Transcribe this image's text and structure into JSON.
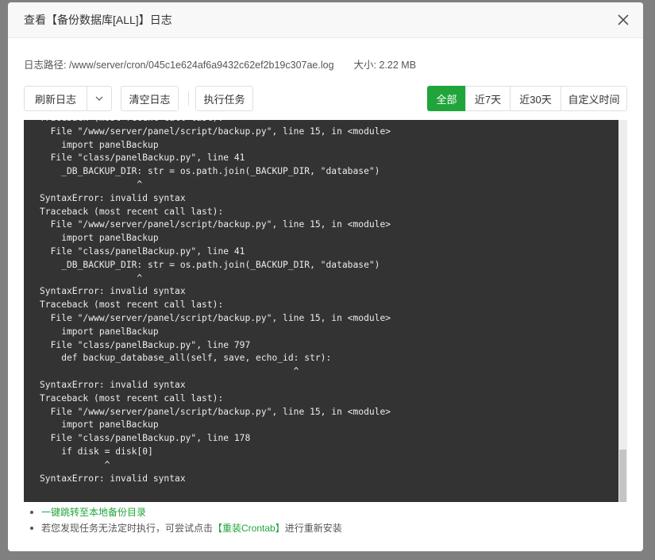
{
  "dialog": {
    "title": "查看【备份数据库[ALL]】日志"
  },
  "info": {
    "path_label": "日志路径:",
    "path_value": "/www/server/cron/045c1e624af6a9432c62ef2b19c307ae.log",
    "size_label": "大小:",
    "size_value": "2.22 MB"
  },
  "toolbar": {
    "refresh_label": "刷新日志",
    "clear_label": "清空日志",
    "exec_label": "执行任务",
    "filters": [
      "全部",
      "近7天",
      "近30天",
      "自定义时间"
    ],
    "active_filter": "全部"
  },
  "log": {
    "text": "Traceback (most recent call last):\n  File \"/www/server/panel/script/backup.py\", line 15, in <module>\n    import panelBackup\n  File \"class/panelBackup.py\", line 41\n    _DB_BACKUP_DIR: str = os.path.join(_BACKUP_DIR, \"database\")\n                  ^\nSyntaxError: invalid syntax\nTraceback (most recent call last):\n  File \"/www/server/panel/script/backup.py\", line 15, in <module>\n    import panelBackup\n  File \"class/panelBackup.py\", line 41\n    _DB_BACKUP_DIR: str = os.path.join(_BACKUP_DIR, \"database\")\n                  ^\nSyntaxError: invalid syntax\nTraceback (most recent call last):\n  File \"/www/server/panel/script/backup.py\", line 15, in <module>\n    import panelBackup\n  File \"class/panelBackup.py\", line 797\n    def backup_database_all(self, save, echo_id: str):\n                                               ^\nSyntaxError: invalid syntax\nTraceback (most recent call last):\n  File \"/www/server/panel/script/backup.py\", line 15, in <module>\n    import panelBackup\n  File \"class/panelBackup.py\", line 178\n    if disk = disk[0]\n            ^\nSyntaxError: invalid syntax"
  },
  "notes": {
    "jump_link": "一键跳转至本地备份目录",
    "reinstall_prefix": "若您发现任务无法定时执行，可尝试点击",
    "reinstall_link": "【重装Crontab】",
    "reinstall_suffix": "进行重新安装"
  },
  "colors": {
    "accent": "#20a53a",
    "log_bg": "#333333"
  },
  "icons": [
    "close-icon",
    "chevron-down-icon"
  ]
}
